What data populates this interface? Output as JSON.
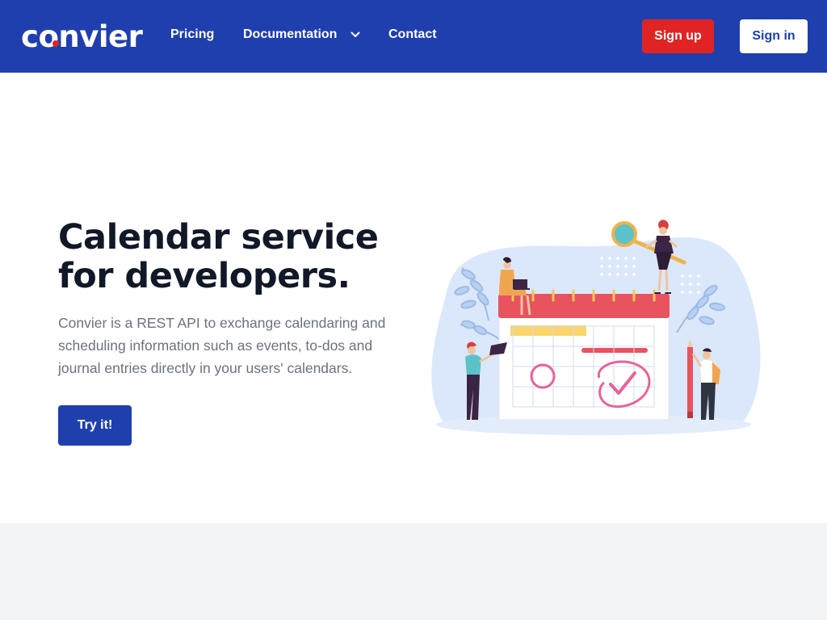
{
  "brand": {
    "logo_text_pre": "c",
    "logo_text_o": "o",
    "logo_text_post": "nvier",
    "accent_dot_color": "#e02424"
  },
  "nav": {
    "links": [
      {
        "label": "Pricing"
      },
      {
        "label": "Documentation",
        "icon": "chevron-down-icon"
      },
      {
        "label": "Contact"
      }
    ],
    "signup_label": "Sign up",
    "signin_label": "Sign in"
  },
  "hero": {
    "title_line1": "Calendar service",
    "title_line2": "for developers.",
    "description": "Convier is a REST API to exchange calendaring and scheduling information such as events, to-dos and journal entries directly in your users' calendars.",
    "cta_label": "Try it!"
  },
  "colors": {
    "primary": "#1f3fae",
    "danger": "#e02424",
    "text_dark": "#111827",
    "text_muted": "#6b7280",
    "band": "#f3f4f6"
  }
}
